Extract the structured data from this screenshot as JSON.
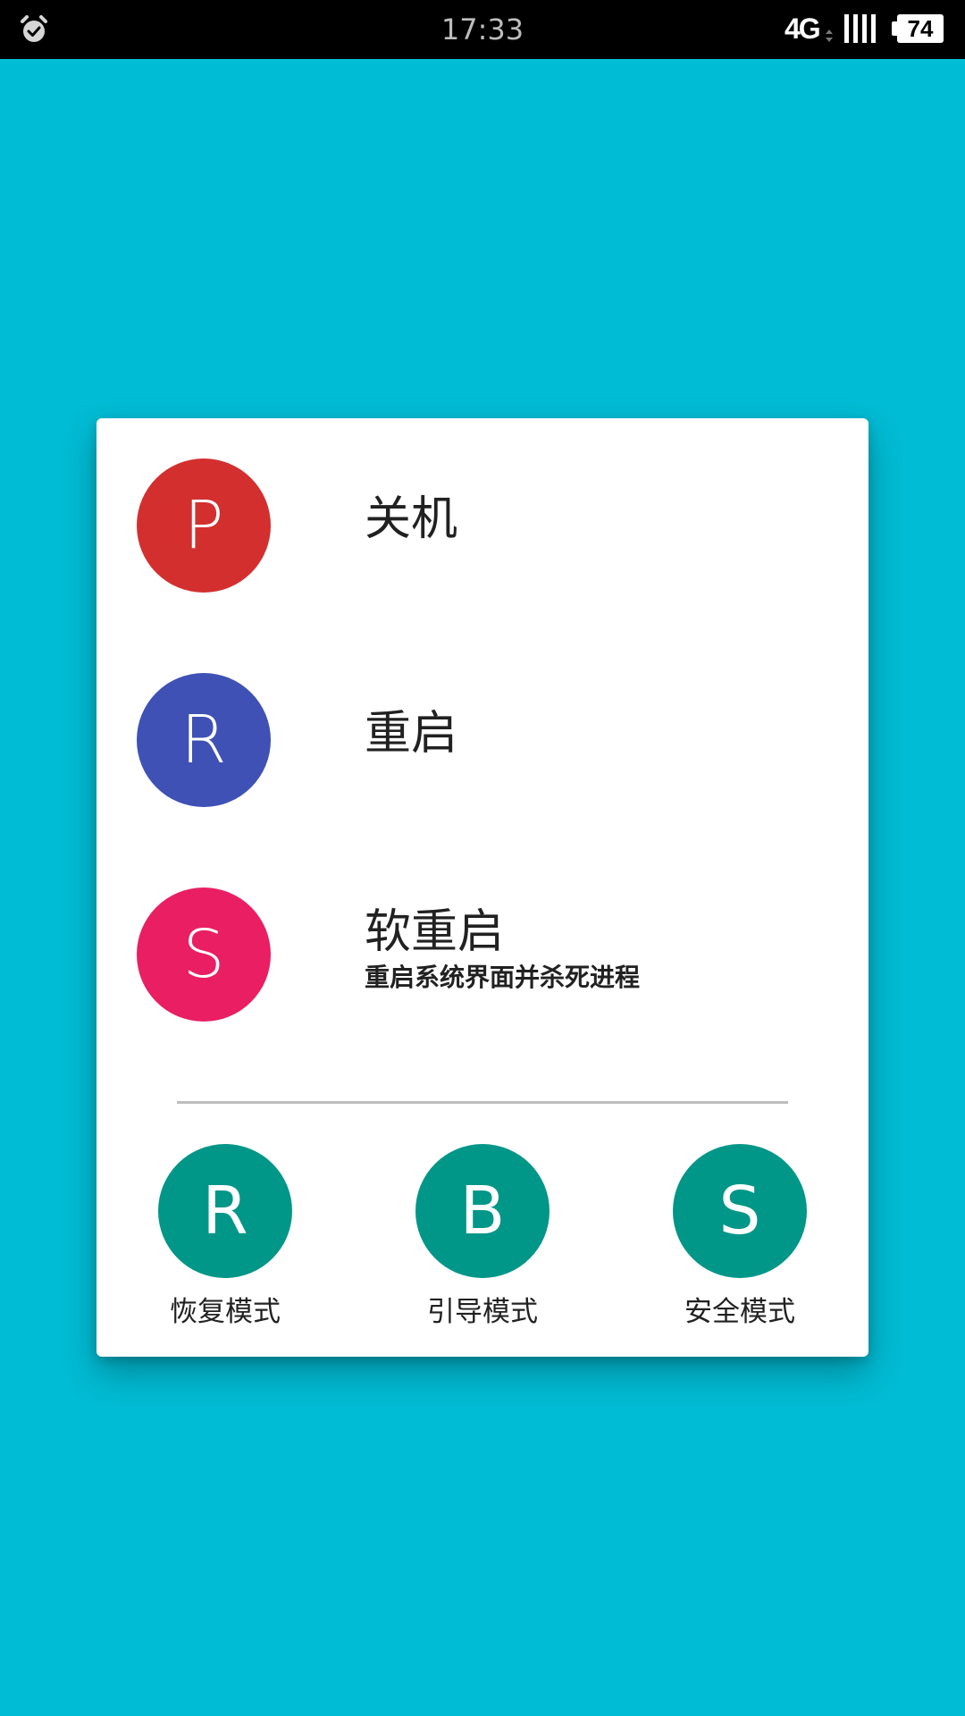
{
  "status_bar": {
    "time": "17:33",
    "network": "4G",
    "battery": "74",
    "icons": [
      "alarm-icon",
      "network-arrows-icon",
      "signal-icon",
      "battery-icon"
    ]
  },
  "colors": {
    "background": "#00bcd4",
    "power_off": "#d32f2f",
    "reboot": "#3f51b5",
    "soft_reboot": "#e91e63",
    "mode": "#009688"
  },
  "dialog": {
    "options": [
      {
        "letter": "P",
        "title": "关机",
        "subtitle": ""
      },
      {
        "letter": "R",
        "title": "重启",
        "subtitle": ""
      },
      {
        "letter": "S",
        "title": "软重启",
        "subtitle": "重启系统界面并杀死进程"
      }
    ],
    "modes": [
      {
        "letter": "R",
        "label": "恢复模式"
      },
      {
        "letter": "B",
        "label": "引导模式"
      },
      {
        "letter": "S",
        "label": "安全模式"
      }
    ]
  }
}
